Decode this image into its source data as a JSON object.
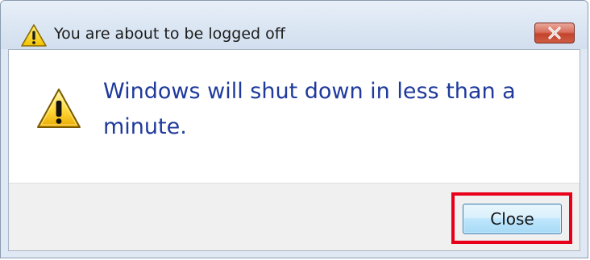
{
  "window": {
    "title": "You are about to be logged off",
    "close_icon": "close-x-icon"
  },
  "dialog": {
    "icon": "warning-icon",
    "message": "Windows will shut down in less than a minute."
  },
  "footer": {
    "close_label": "Close"
  },
  "colors": {
    "message_text": "#1f3a9c",
    "highlight_border": "#e8001a",
    "close_caption_red": "#c3442c"
  }
}
